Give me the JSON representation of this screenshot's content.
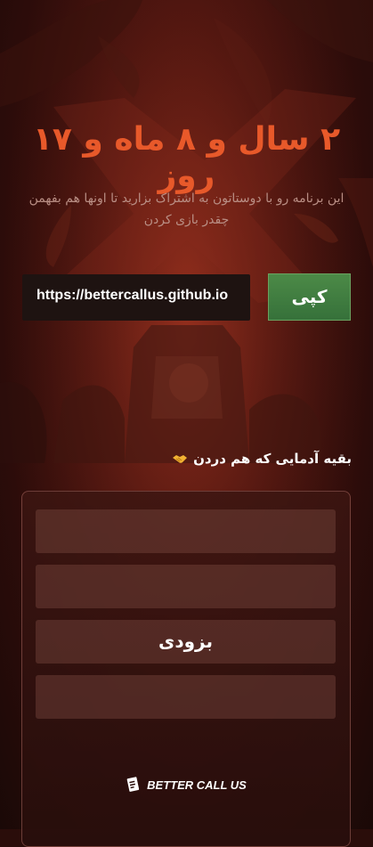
{
  "header": {
    "title": "۲ سال و ۸ ماه و ۱۷ روز",
    "subtitle": "این برنامه رو با دوستاتون به اشتراک بزارید تا اونها هم بفهمن چقدر بازی کردن"
  },
  "share": {
    "url": "https://bettercallus.github.io",
    "copy_label": "کپی"
  },
  "others": {
    "label": "بقیه آدمایی که هم دردن",
    "icon": "handshake-icon",
    "slots": [
      "",
      "",
      "بزودی",
      ""
    ]
  },
  "footer": {
    "brand": "BETTER CALL US",
    "icon": "document-icon"
  },
  "colors": {
    "accent": "#e8592a",
    "button": "#3f7c40"
  }
}
